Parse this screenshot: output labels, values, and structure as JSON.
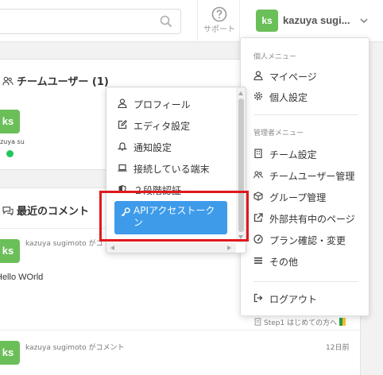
{
  "header": {
    "search": {
      "placeholder": "",
      "icon": "search-icon"
    },
    "support": {
      "label": "サポート",
      "icon": "question-circle-icon"
    },
    "user": {
      "initials": "ks",
      "name": "kazuya sugi...",
      "avatar_color": "#6bbf59"
    }
  },
  "team_card": {
    "title": "チームユーザー (1)",
    "member": {
      "initials": "ks",
      "name": "uzuya su",
      "status_color": "#22c55e"
    }
  },
  "comments_card": {
    "title": "最近のコメント",
    "comments": [
      {
        "initials": "ks",
        "author": "kazuya sugimoto がコ",
        "body": "Hello WOrld",
        "step": "Step1 はじめての方へ"
      },
      {
        "initials": "ks",
        "author": "kazuya sugimoto がコメント",
        "time": "12日前"
      }
    ]
  },
  "account_menu": {
    "personal_header": "個人メニュー",
    "personal_items": [
      {
        "label": "マイページ",
        "icon": "user-icon"
      },
      {
        "label": "個人設定",
        "icon": "gear-icon"
      }
    ],
    "admin_header": "管理者メニュー",
    "admin_items": [
      {
        "label": "チーム設定",
        "icon": "building-icon"
      },
      {
        "label": "チームユーザー管理",
        "icon": "users-icon"
      },
      {
        "label": "グループ管理",
        "icon": "cube-icon"
      },
      {
        "label": "外部共有中のページ",
        "icon": "external-link-icon"
      },
      {
        "label": "プラン確認・変更",
        "icon": "gauge-icon"
      },
      {
        "label": "その他",
        "icon": "bars-icon"
      }
    ],
    "logout": {
      "label": "ログアウト",
      "icon": "sign-out-icon"
    }
  },
  "settings_menu": {
    "items": [
      {
        "label": "プロフィール",
        "icon": "user-icon"
      },
      {
        "label": "エディタ設定",
        "icon": "edit-icon"
      },
      {
        "label": "通知設定",
        "icon": "bell-icon"
      },
      {
        "label": "接続している端末",
        "icon": "laptop-icon"
      },
      {
        "label": "２段階認証",
        "icon": "shield-icon"
      }
    ],
    "active": {
      "label": "APIアクセストークン",
      "icon": "key-icon",
      "color": "#3d9bea"
    }
  },
  "highlight_color": "#e0181c"
}
